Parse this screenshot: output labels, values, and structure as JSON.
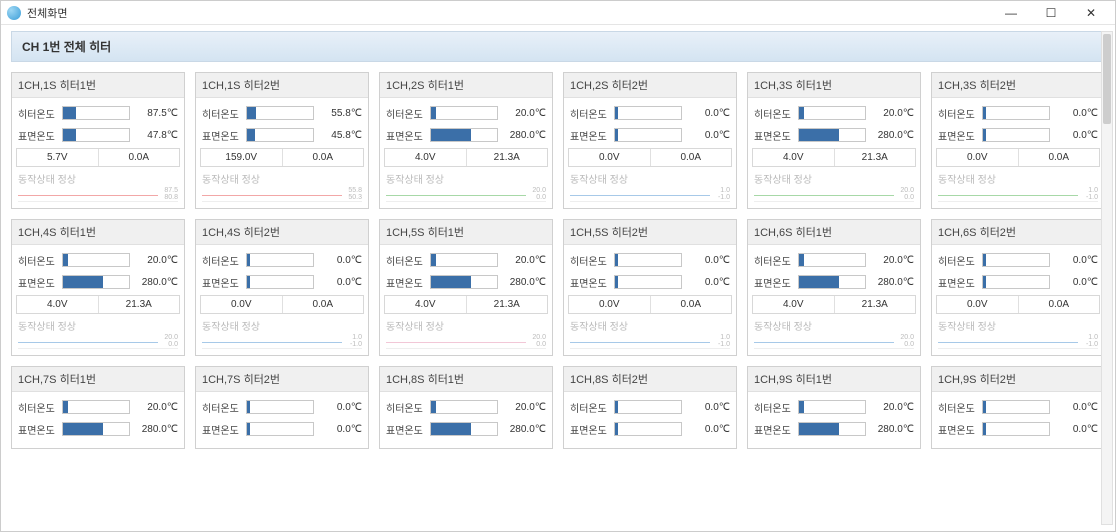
{
  "window": {
    "title": "전체화면",
    "min": "—",
    "max": "☐",
    "close": "✕"
  },
  "header": "CH 1번 전체 히터",
  "labels": {
    "heater_temp": "히터온도",
    "surface_temp": "표면온도",
    "status": "동작상태 정상"
  },
  "colors": {
    "bar": "#3b6fa8",
    "spark_red": "#f2a7a7",
    "spark_green": "#a7d8a7",
    "spark_blue": "#a7c9e8",
    "spark_pink": "#f2c7d7"
  },
  "cards": [
    {
      "title": "1CH,1S 히터1번",
      "ht_val": "87.5℃",
      "ht_pct": 20,
      "sf_val": "47.8℃",
      "sf_pct": 20,
      "volt": "5.7V",
      "amp": "0.0A",
      "spark": "red",
      "ticks": [
        "87.5",
        "80.8"
      ]
    },
    {
      "title": "1CH,1S 히터2번",
      "ht_val": "55.8℃",
      "ht_pct": 14,
      "sf_val": "45.8℃",
      "sf_pct": 12,
      "volt": "159.0V",
      "amp": "0.0A",
      "spark": "red",
      "ticks": [
        "55.8",
        "50.3"
      ]
    },
    {
      "title": "1CH,2S 히터1번",
      "ht_val": "20.0℃",
      "ht_pct": 8,
      "sf_val": "280.0℃",
      "sf_pct": 60,
      "volt": "4.0V",
      "amp": "21.3A",
      "spark": "green",
      "ticks": [
        "20.0",
        "0.0"
      ]
    },
    {
      "title": "1CH,2S 히터2번",
      "ht_val": "0.0℃",
      "ht_pct": 4,
      "sf_val": "0.0℃",
      "sf_pct": 4,
      "volt": "0.0V",
      "amp": "0.0A",
      "spark": "blue",
      "ticks": [
        "1.0",
        "-1.0"
      ]
    },
    {
      "title": "1CH,3S 히터1번",
      "ht_val": "20.0℃",
      "ht_pct": 8,
      "sf_val": "280.0℃",
      "sf_pct": 60,
      "volt": "4.0V",
      "amp": "21.3A",
      "spark": "green",
      "ticks": [
        "20.0",
        "0.0"
      ]
    },
    {
      "title": "1CH,3S 히터2번",
      "ht_val": "0.0℃",
      "ht_pct": 4,
      "sf_val": "0.0℃",
      "sf_pct": 4,
      "volt": "0.0V",
      "amp": "0.0A",
      "spark": "green",
      "ticks": [
        "1.0",
        "-1.0"
      ]
    },
    {
      "title": "1CH,4S 히터1번",
      "ht_val": "20.0℃",
      "ht_pct": 8,
      "sf_val": "280.0℃",
      "sf_pct": 60,
      "volt": "4.0V",
      "amp": "21.3A",
      "spark": "blue",
      "ticks": [
        "20.0",
        "0.0"
      ]
    },
    {
      "title": "1CH,4S 히터2번",
      "ht_val": "0.0℃",
      "ht_pct": 4,
      "sf_val": "0.0℃",
      "sf_pct": 4,
      "volt": "0.0V",
      "amp": "0.0A",
      "spark": "blue",
      "ticks": [
        "1.0",
        "-1.0"
      ]
    },
    {
      "title": "1CH,5S 히터1번",
      "ht_val": "20.0℃",
      "ht_pct": 8,
      "sf_val": "280.0℃",
      "sf_pct": 60,
      "volt": "4.0V",
      "amp": "21.3A",
      "spark": "pink",
      "ticks": [
        "20.0",
        "0.0"
      ]
    },
    {
      "title": "1CH,5S 히터2번",
      "ht_val": "0.0℃",
      "ht_pct": 4,
      "sf_val": "0.0℃",
      "sf_pct": 4,
      "volt": "0.0V",
      "amp": "0.0A",
      "spark": "blue",
      "ticks": [
        "1.0",
        "-1.0"
      ]
    },
    {
      "title": "1CH,6S 히터1번",
      "ht_val": "20.0℃",
      "ht_pct": 8,
      "sf_val": "280.0℃",
      "sf_pct": 60,
      "volt": "4.0V",
      "amp": "21.3A",
      "spark": "blue",
      "ticks": [
        "20.0",
        "0.0"
      ]
    },
    {
      "title": "1CH,6S 히터2번",
      "ht_val": "0.0℃",
      "ht_pct": 4,
      "sf_val": "0.0℃",
      "sf_pct": 4,
      "volt": "0.0V",
      "amp": "0.0A",
      "spark": "blue",
      "ticks": [
        "1.0",
        "-1.0"
      ]
    },
    {
      "title": "1CH,7S 히터1번",
      "ht_val": "20.0℃",
      "ht_pct": 8,
      "sf_val": "280.0℃",
      "sf_pct": 60,
      "volt": "",
      "amp": "",
      "spark": "",
      "ticks": [
        "",
        ""
      ]
    },
    {
      "title": "1CH,7S 히터2번",
      "ht_val": "0.0℃",
      "ht_pct": 4,
      "sf_val": "0.0℃",
      "sf_pct": 4,
      "volt": "",
      "amp": "",
      "spark": "",
      "ticks": [
        "",
        ""
      ]
    },
    {
      "title": "1CH,8S 히터1번",
      "ht_val": "20.0℃",
      "ht_pct": 8,
      "sf_val": "280.0℃",
      "sf_pct": 60,
      "volt": "",
      "amp": "",
      "spark": "",
      "ticks": [
        "",
        ""
      ]
    },
    {
      "title": "1CH,8S 히터2번",
      "ht_val": "0.0℃",
      "ht_pct": 4,
      "sf_val": "0.0℃",
      "sf_pct": 4,
      "volt": "",
      "amp": "",
      "spark": "",
      "ticks": [
        "",
        ""
      ]
    },
    {
      "title": "1CH,9S 히터1번",
      "ht_val": "20.0℃",
      "ht_pct": 8,
      "sf_val": "280.0℃",
      "sf_pct": 60,
      "volt": "",
      "amp": "",
      "spark": "",
      "ticks": [
        "",
        ""
      ]
    },
    {
      "title": "1CH,9S 히터2번",
      "ht_val": "0.0℃",
      "ht_pct": 4,
      "sf_val": "0.0℃",
      "sf_pct": 4,
      "volt": "",
      "amp": "",
      "spark": "",
      "ticks": [
        "",
        ""
      ]
    }
  ]
}
